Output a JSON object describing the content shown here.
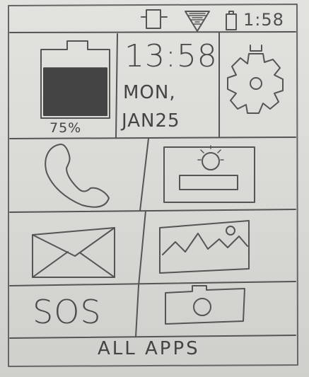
{
  "status_bar": {
    "time": "1:58",
    "icons": [
      "vibrate-icon",
      "wifi-icon",
      "battery-icon"
    ]
  },
  "widgets": {
    "battery_percent": 75,
    "battery_label": "75%",
    "clock_time": "13:58",
    "day": "MON,",
    "date": "JAN25",
    "settings_icon": "gear-icon"
  },
  "apps": [
    {
      "name": "phone",
      "icon": "phone-icon"
    },
    {
      "name": "contacts",
      "icon": "contact-card-icon"
    },
    {
      "name": "messages",
      "icon": "envelope-icon"
    },
    {
      "name": "gallery",
      "icon": "image-icon"
    },
    {
      "name": "sos",
      "label": "SOS"
    },
    {
      "name": "camera",
      "icon": "camera-icon"
    }
  ],
  "bottom": {
    "all_apps_label": "ALL APPS"
  }
}
